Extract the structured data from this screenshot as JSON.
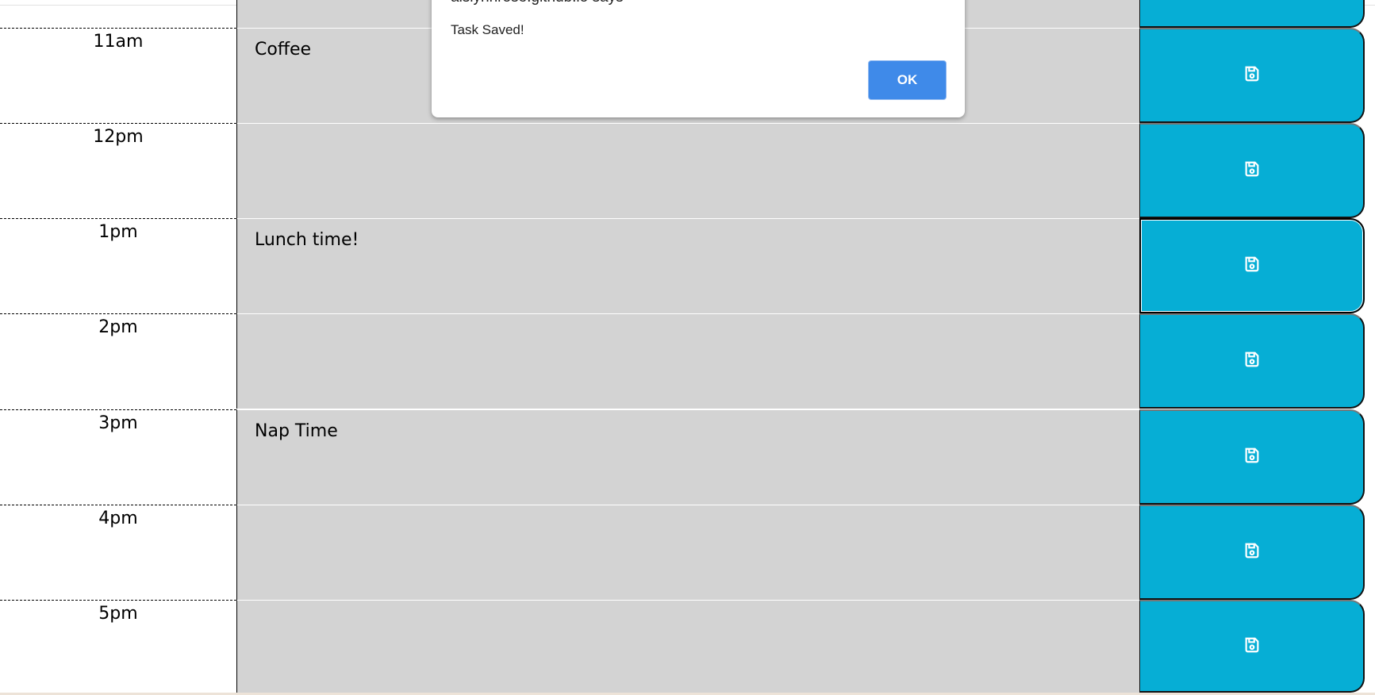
{
  "dialog": {
    "origin": "aislynnrose.github.io says",
    "message": "Task Saved!",
    "ok_label": "OK"
  },
  "rows": [
    {
      "hour": "",
      "task": ""
    },
    {
      "hour": "11am",
      "task": "Coffee"
    },
    {
      "hour": "12pm",
      "task": ""
    },
    {
      "hour": "1pm",
      "task": "Lunch time!"
    },
    {
      "hour": "2pm",
      "task": ""
    },
    {
      "hour": "3pm",
      "task": "Nap Time"
    },
    {
      "hour": "4pm",
      "task": ""
    },
    {
      "hour": "5pm",
      "task": ""
    }
  ],
  "colors": {
    "save_button": "#06aed5",
    "past_row": "#d3d3d3",
    "ok_button": "#3f8ae9"
  },
  "icons": {
    "save": "floppy-disk-icon"
  }
}
